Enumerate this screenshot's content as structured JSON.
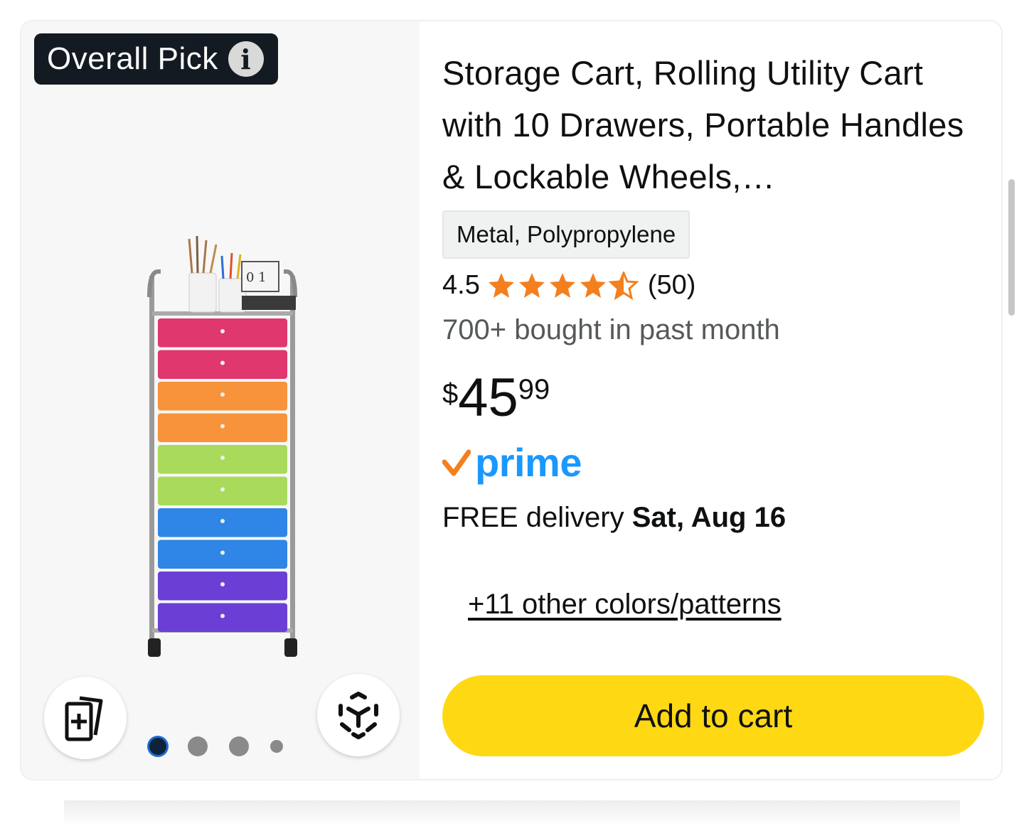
{
  "badge": {
    "label": "Overall Pick",
    "info_icon": "info-icon"
  },
  "product": {
    "title": "Storage Cart, Rolling Utility Cart with 10 Drawers, Portable Handles & Lockable Wheels,…",
    "image_text": "0 1",
    "material": "Metal, Polypropylene",
    "rating": "4.5",
    "rating_value": 4.5,
    "review_count": "(50)",
    "bought": "700+ bought in past month",
    "price": {
      "symbol": "$",
      "whole": "45",
      "fraction": "99"
    },
    "prime_label": "prime",
    "delivery": {
      "prefix": "FREE delivery ",
      "date": "Sat, Aug 16"
    },
    "colors_link": "+11 other colors/patterns",
    "add_to_cart": "Add to cart"
  },
  "image_controls": {
    "compare_icon": "add-to-compare-icon",
    "view_3d_icon": "view-in-3d-icon",
    "carousel_dots": 4,
    "active_dot": 0
  },
  "colors": {
    "badge_bg": "#131a22",
    "star": "#f47f1e",
    "prime_blue": "#1a98ff",
    "prime_check": "#f47f1e",
    "button": "#ffd814",
    "drawer_colors": [
      "#e0376f",
      "#e0376f",
      "#f7943b",
      "#f7943b",
      "#a9da5b",
      "#a9da5b",
      "#2f86e6",
      "#2f86e6",
      "#6b3fd6",
      "#6b3fd6"
    ]
  }
}
